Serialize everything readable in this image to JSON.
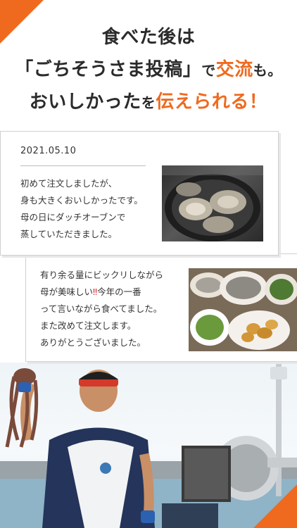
{
  "headline": {
    "line1": "食べた後は",
    "line2_part1": "「ごちそうさま投稿」",
    "line2_part2": "で",
    "line2_accent1": "交流",
    "line2_part3": "も。",
    "line3_part1": "おいしかった",
    "line3_part2": "を",
    "line3_accent": "伝えられる！"
  },
  "review1": {
    "date": "2021.05.10",
    "lines": [
      "初めて注文しましたが、",
      "身も大きくおいしかったです。",
      "母の日にダッチオーブンで",
      "蒸していただきました。"
    ]
  },
  "review2": {
    "line1": "有り余る量にビックリしながら",
    "line2_part1": "母が美味しい",
    "line2_bang": "‼",
    "line2_part2": "今年の一番",
    "line3": "って言いながら食べてました。",
    "line4": "また改めて注文します。",
    "line5": "ありがとうございました。"
  },
  "colors": {
    "accent": "#ef6a1e",
    "text": "#2b2b2b",
    "exclaim": "#d82626"
  }
}
